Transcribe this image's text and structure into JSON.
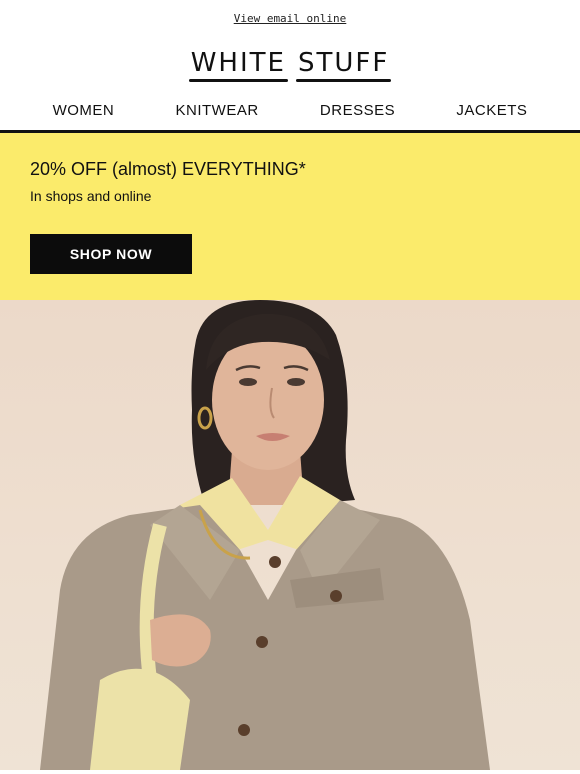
{
  "header": {
    "view_online": "View email online",
    "logo_word1": "WHITE",
    "logo_word2": "STUFF"
  },
  "nav": {
    "items": [
      "WOMEN",
      "KNITWEAR",
      "DRESSES",
      "JACKETS"
    ]
  },
  "promo": {
    "title": "20% OFF (almost) EVERYTHING*",
    "subtitle": "In shops and online",
    "button_label": "SHOP NOW",
    "background_color": "#fbeb6b",
    "button_color": "#0c0c0c"
  },
  "hero": {
    "background_color": "#ecd9c9",
    "jacket_color": "#a99a89"
  }
}
